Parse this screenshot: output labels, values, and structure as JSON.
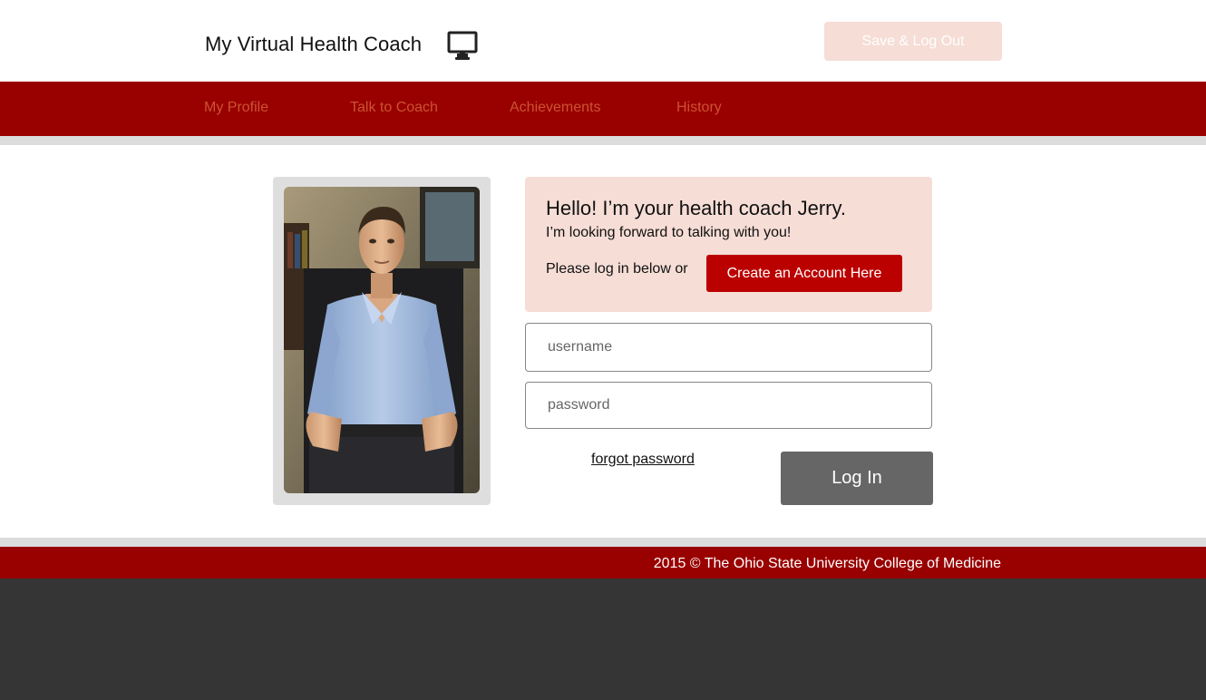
{
  "header": {
    "title": "My Virtual Health Coach",
    "monitor_icon": "monitor-icon",
    "logout_label": "Save & Log Out"
  },
  "nav": {
    "items": [
      {
        "label": "My Profile"
      },
      {
        "label": "Talk to Coach"
      },
      {
        "label": "Achievements"
      },
      {
        "label": "History"
      }
    ]
  },
  "welcome": {
    "title": "Hello! I’m your health coach Jerry.",
    "subtitle": "I’m looking forward to talking with you!",
    "prompt": "Please log in below or",
    "create_label": "Create an Account Here"
  },
  "login": {
    "username_placeholder": "username",
    "password_placeholder": "password",
    "forgot_label": "forgot password",
    "login_label": "Log In"
  },
  "footer": {
    "text": "2015 © The Ohio State University College of Medicine"
  },
  "colors": {
    "brand_red": "#990000",
    "button_red": "#bb0000",
    "nav_text": "#cc5233",
    "pink_panel": "#f6ddd6",
    "login_gray": "#666666",
    "dark_bg": "#353535"
  }
}
